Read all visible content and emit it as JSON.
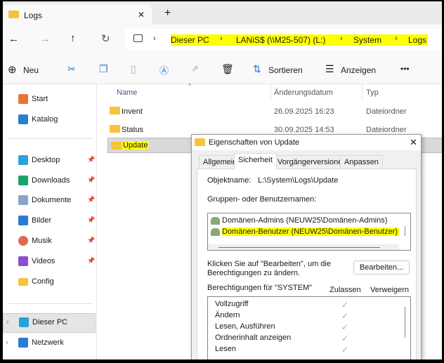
{
  "tab": {
    "title": "Logs",
    "close": "✕",
    "new_tab": "+"
  },
  "nav": {
    "back": "←",
    "forward": "→",
    "up": "↑",
    "refresh": "↻"
  },
  "breadcrumb": [
    "Dieser PC",
    "LANiS$ (\\\\M25-507) (L:)",
    "System",
    "Logs"
  ],
  "toolbar": {
    "new": "Neu",
    "sort": "Sortieren",
    "view": "Anzeigen",
    "more": "•••"
  },
  "sidebar": {
    "items": [
      {
        "label": "Start",
        "color": "#e8743b"
      },
      {
        "label": "Katalog",
        "color": "#2b7cd3"
      },
      {
        "label": "Desktop",
        "color": "#2ea1e0",
        "pinned": true
      },
      {
        "label": "Downloads",
        "color": "#1aa36b",
        "pinned": true
      },
      {
        "label": "Dokumente",
        "color": "#8aa4c8",
        "pinned": true
      },
      {
        "label": "Bilder",
        "color": "#2b7cd3",
        "pinned": true
      },
      {
        "label": "Musik",
        "color": "#e06a50",
        "pinned": true
      },
      {
        "label": "Videos",
        "color": "#8a4fd6",
        "pinned": true
      },
      {
        "label": "Config",
        "color": "#f7c33a"
      },
      {
        "label": "Dieser PC",
        "color": "#25a3d9"
      },
      {
        "label": "Netzwerk",
        "color": "#2b7cd3"
      }
    ]
  },
  "columns": {
    "name": "Name",
    "date": "Änderungsdatum",
    "type": "Typ"
  },
  "files": [
    {
      "name": "Invent",
      "date": "26.09.2025 16:23",
      "type": "Dateiordner"
    },
    {
      "name": "Status",
      "date": "30.09.2025 14:53",
      "type": "Dateiordner"
    },
    {
      "name": "Update",
      "date": "",
      "type": ""
    }
  ],
  "dialog": {
    "title": "Eigenschaften von Update",
    "close": "✕",
    "tabs": [
      "Allgemein",
      "Sicherheit",
      "Vorgängerversionen",
      "Anpassen"
    ],
    "object_label": "Objektname:",
    "object_value": "L:\\System\\Logs\\Update",
    "groups_label": "Gruppen- oder Benutzernamen:",
    "groups": [
      "Domänen-Admins (NEUW25\\Domänen-Admins)",
      "Domänen-Benutzer (NEUW25\\Domänen-Benutzer)"
    ],
    "edit_hint_1": "Klicken Sie auf \"Bearbeiten\", um die",
    "edit_hint_2": "Berechtigungen zu ändern.",
    "edit_button": "Bearbeiten...",
    "perm_label": "Berechtigungen für \"SYSTEM\"",
    "allow": "Zulassen",
    "deny": "Verweigern",
    "permissions": [
      {
        "name": "Vollzugriff",
        "allow": true
      },
      {
        "name": "Ändern",
        "allow": true
      },
      {
        "name": "Lesen, Ausführen",
        "allow": true
      },
      {
        "name": "Ordnerinhalt anzeigen",
        "allow": true
      },
      {
        "name": "Lesen",
        "allow": true
      }
    ],
    "check": "✓"
  }
}
